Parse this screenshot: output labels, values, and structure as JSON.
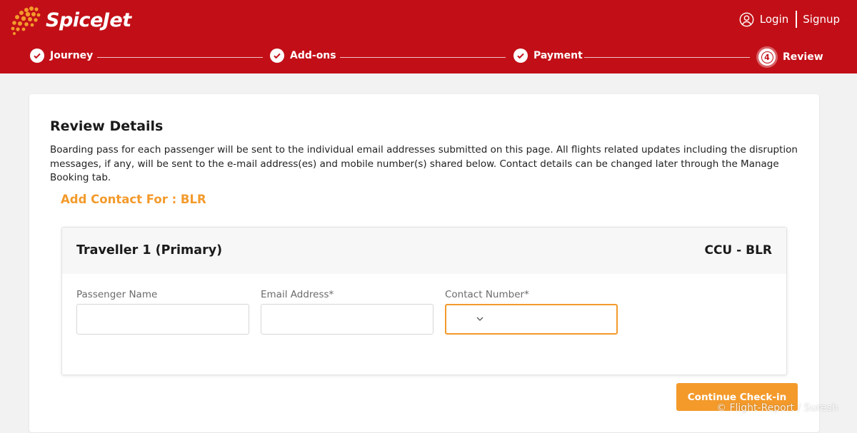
{
  "header": {
    "brand": "SpiceJet",
    "login_label": "Login",
    "signup_label": "Signup",
    "brand_color": "#c20f17",
    "accent_color": "#f39a2b"
  },
  "stepper": {
    "steps": [
      {
        "label": "Journey",
        "status": "done"
      },
      {
        "label": "Add-ons",
        "status": "done"
      },
      {
        "label": "Payment",
        "status": "done"
      },
      {
        "label": "Review",
        "status": "current",
        "number": "4"
      }
    ]
  },
  "review": {
    "title": "Review Details",
    "description": "Boarding pass for each passenger will be sent to the individual email addresses submitted on this page. All flights related updates including the disruption messages, if any, will be sent to the e-mail address(es) and mobile number(s) shared below. Contact details can be changed later through the Manage Booking tab.",
    "add_contact_label": "Add Contact For : BLR"
  },
  "traveller": {
    "name": "Traveller 1 (Primary)",
    "route": "CCU - BLR",
    "fields": {
      "passenger_name_label": "Passenger Name",
      "passenger_name_value": "",
      "email_label": "Email Address*",
      "email_value": "",
      "contact_label": "Contact Number*",
      "contact_value": ""
    }
  },
  "actions": {
    "continue_label": "Continue Check-in"
  },
  "watermark": "© Flight-Report / Suresh"
}
